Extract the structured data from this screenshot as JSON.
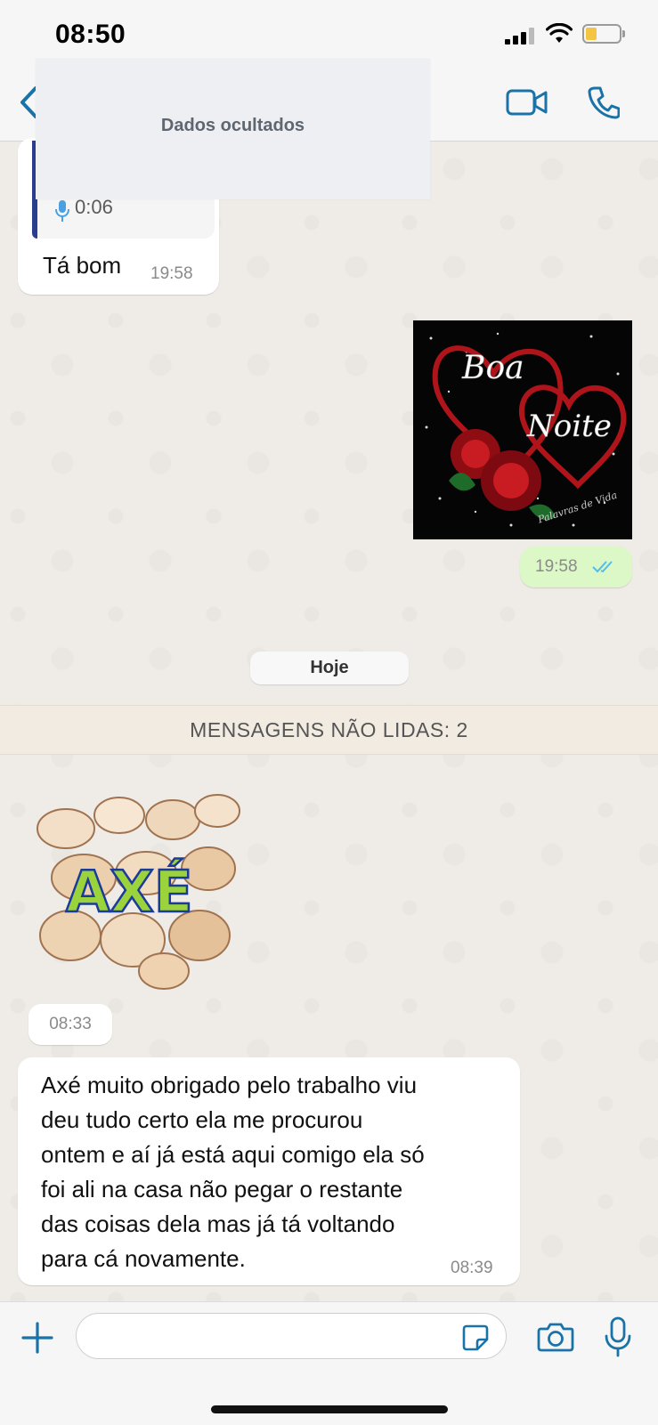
{
  "status_bar": {
    "time": "08:50",
    "battery_level": 0.2
  },
  "header": {
    "back_icon": "chevron-left-icon",
    "video_icon": "video-camera-icon",
    "call_icon": "phone-icon",
    "accent_color": "#1a73a8"
  },
  "overlay": {
    "text": "Dados ocultados"
  },
  "messages": [
    {
      "direction": "in",
      "reply_duration": "0:06",
      "text": "Tá bom",
      "time": "19:58"
    },
    {
      "direction": "out",
      "type": "image",
      "image_text_1": "Boa",
      "image_text_2": "Noite",
      "image_signature": "Palavras de Vida",
      "time": "19:58",
      "status": "read"
    }
  ],
  "date_separator": "Hoje",
  "unread_banner": "MENSAGENS NÃO LIDAS: 2",
  "sticker": {
    "text": "AXÉ",
    "time": "08:33"
  },
  "last_message": {
    "lines": [
      "Axé muito obrigado pelo trabalho viu",
      "deu tudo certo ela me procurou",
      "ontem e aí já está aqui comigo ela só",
      "foi ali na casa não pegar o restante",
      "das coisas dela mas já tá voltando",
      "para cá novamente."
    ],
    "time": "08:39"
  },
  "composer": {
    "placeholder": "",
    "value": ""
  },
  "colors": {
    "outgoing_bubble": "#dcf8c6",
    "incoming_bubble": "#ffffff",
    "tick_blue": "#53bdeb"
  }
}
